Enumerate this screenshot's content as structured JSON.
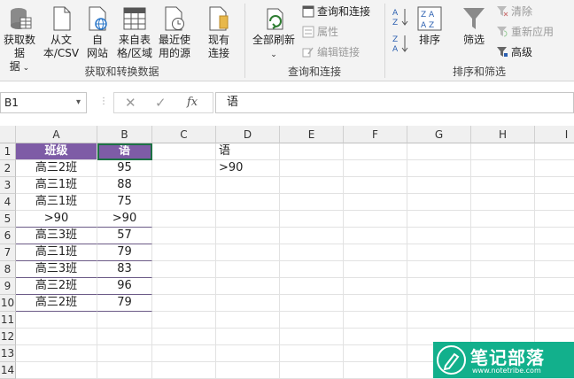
{
  "ribbon": {
    "get_transform": {
      "get_data": "获取数据",
      "get_data_2": "据",
      "from_text": "从文本/CSV",
      "from_text_1": "从文",
      "from_text_2": "本/CSV",
      "from_web_1": "自",
      "from_web_2": "网站",
      "from_table_1": "来自表",
      "from_table_2": "格/区域",
      "recent_1": "最近使",
      "recent_2": "用的源",
      "existing_1": "现有",
      "existing_2": "连接",
      "label": "获取和转换数据"
    },
    "queries": {
      "refresh_all": "全部刷新",
      "queries_connections": "查询和连接",
      "properties": "属性",
      "edit_links": "编辑链接",
      "label": "查询和连接"
    },
    "sort_filter": {
      "sort": "排序",
      "filter": "筛选",
      "clear": "清除",
      "reapply": "重新应用",
      "advanced": "高级",
      "label": "排序和筛选"
    }
  },
  "formula_bar": {
    "name_box": "B1",
    "cancel": "✕",
    "enter": "✓",
    "fx": "fx",
    "content": "语"
  },
  "columns": [
    "A",
    "B",
    "C",
    "D",
    "E",
    "F",
    "G",
    "H",
    "I"
  ],
  "rows": [
    "1",
    "2",
    "3",
    "4",
    "5",
    "6",
    "7",
    "8",
    "9",
    "10",
    "11",
    "12",
    "13",
    "14"
  ],
  "cells": {
    "A1": "班级",
    "B1": "语",
    "A2": "高三2班",
    "B2": "95",
    "A3": "高三1班",
    "B3": "88",
    "A4": "高三1班",
    "B4": "75",
    "A5": ">90",
    "B5": ">90",
    "A6": "高三3班",
    "B6": "57",
    "A7": "高三1班",
    "B7": "79",
    "A8": "高三3班",
    "B8": "83",
    "A9": "高三2班",
    "B9": "96",
    "A10": "高三2班",
    "B10": "79",
    "D1": "语",
    "D2": ">90"
  },
  "watermark": {
    "title": "笔记部落",
    "url": "www.notetribe.com"
  },
  "colors": {
    "header_fill": "#7e5ca6",
    "watermark": "#12b08c"
  }
}
